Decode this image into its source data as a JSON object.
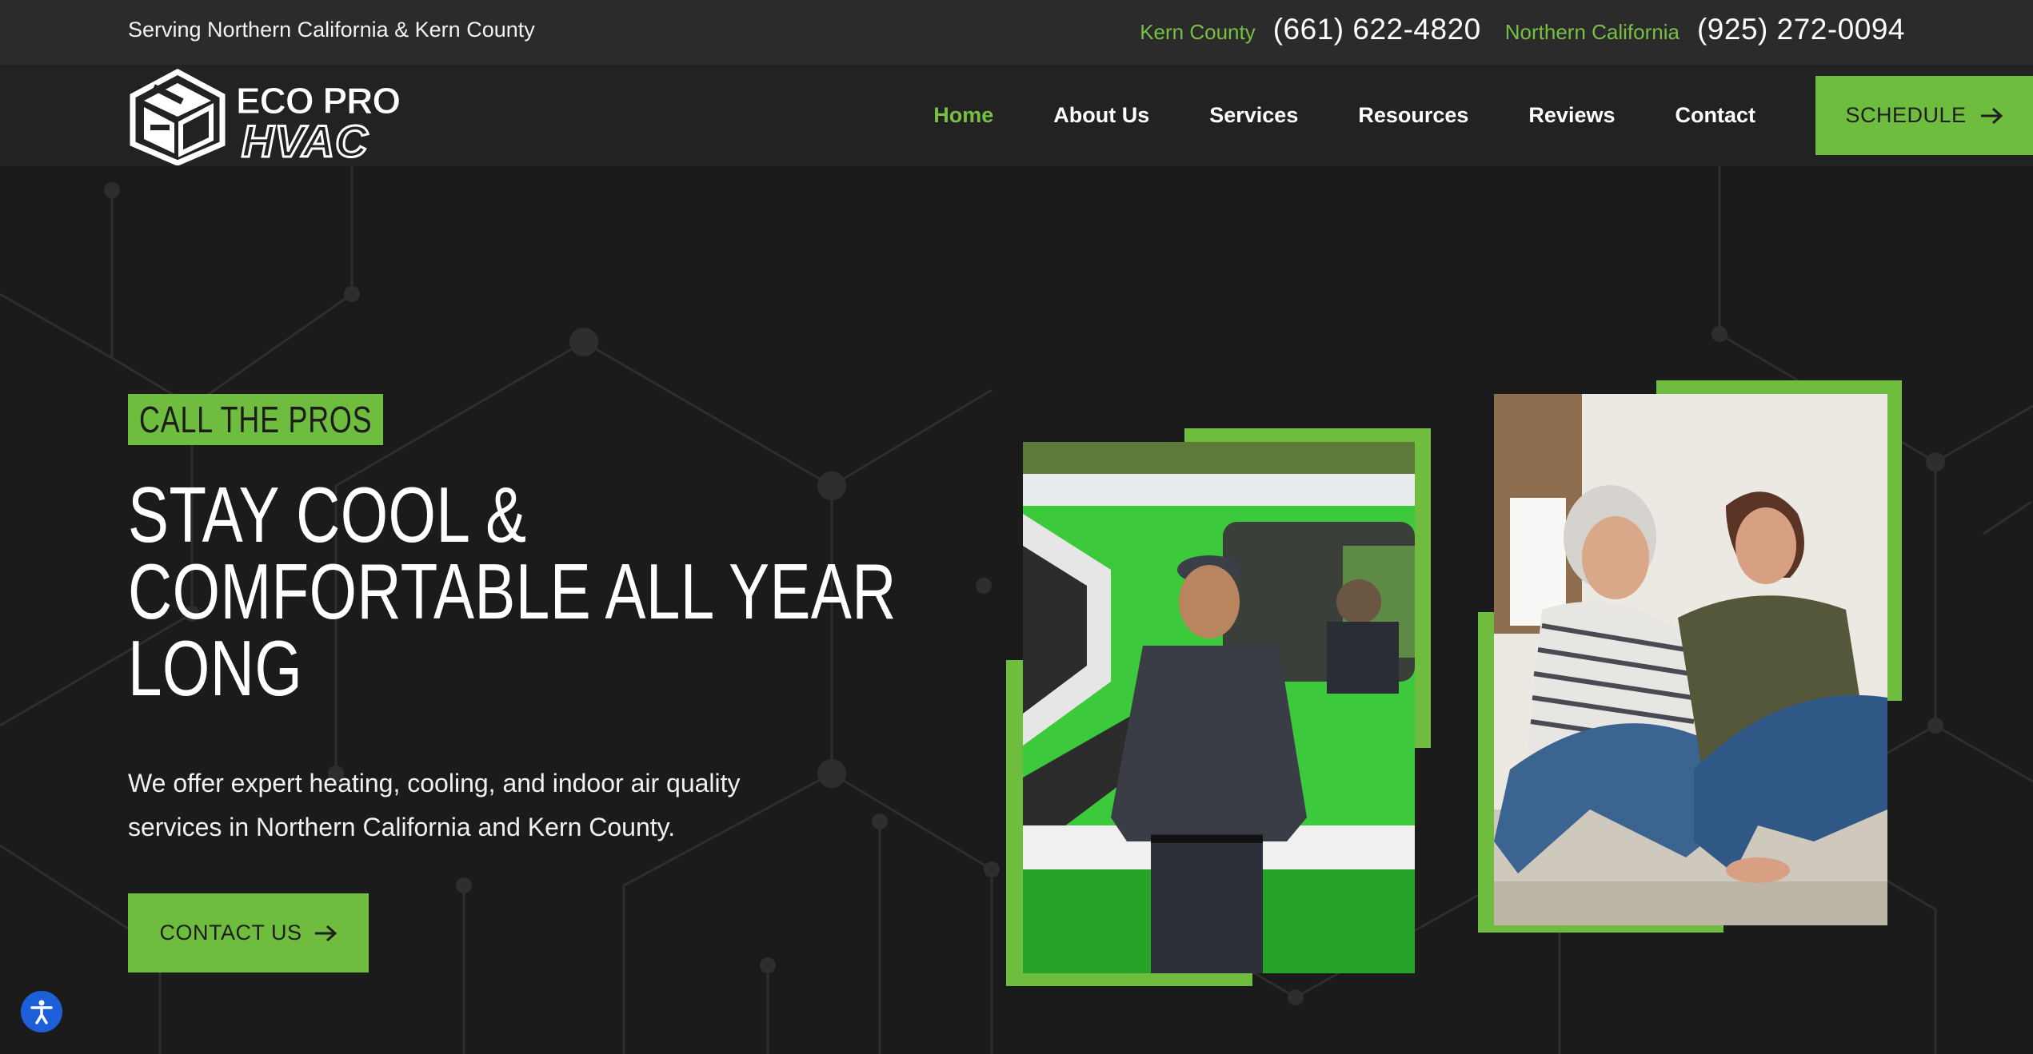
{
  "topbar": {
    "serving_text": "Serving Northern California & Kern County",
    "contacts": [
      {
        "region": "Kern County",
        "phone": "(661) 622-4820"
      },
      {
        "region": "Northern California",
        "phone": "(925) 272-0094"
      }
    ]
  },
  "logo": {
    "line1": "ECO PRO",
    "line2": "HVAC"
  },
  "nav": {
    "items": [
      {
        "label": "Home",
        "active": true
      },
      {
        "label": "About Us",
        "active": false
      },
      {
        "label": "Services",
        "active": false
      },
      {
        "label": "Resources",
        "active": false
      },
      {
        "label": "Reviews",
        "active": false
      },
      {
        "label": "Contact",
        "active": false
      }
    ],
    "schedule_label": "SCHEDULE"
  },
  "hero": {
    "eyebrow": "CALL THE PROS",
    "headline_lines": [
      "STAY COOL &",
      "COMFORTABLE ALL YEAR",
      "LONG"
    ],
    "intro_line1": "We offer expert heating, cooling, and indoor air quality",
    "intro_line2": "services in Northern California and Kern County.",
    "contact_label": "CONTACT US"
  },
  "colors": {
    "accent": "#6fbd3e",
    "topbar": "#2b2b2b",
    "header": "#222222",
    "hero_bg": "#1b1b1b"
  },
  "icons": {
    "arrow": "arrow-right-icon",
    "accessibility": "accessibility-icon"
  }
}
